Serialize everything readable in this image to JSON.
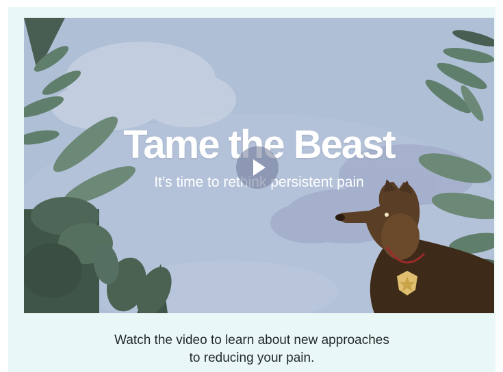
{
  "video": {
    "title": "Tame the Beast",
    "subtitle": "It’s time to rethink persistent pain",
    "play_icon": "play-icon"
  },
  "caption": {
    "line1": "Watch the video to learn about new approaches",
    "line2": "to reducing your pain."
  },
  "colors": {
    "panel_bg": "#e9f7f6",
    "sky": "#aebfd6",
    "leaf": "#5f7f6c",
    "dog": "#5a3f26",
    "text": "#1f2a2a"
  }
}
